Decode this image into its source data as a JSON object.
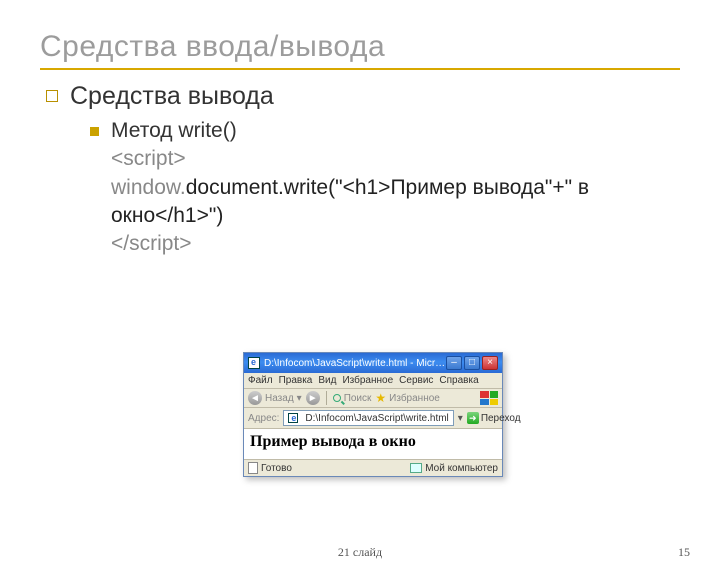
{
  "title": "Средства ввода/вывода",
  "lvl1": "Средства вывода",
  "lvl2": "Метод write()",
  "code": {
    "open": "<script>",
    "grayWord": "window.",
    "mid": "document.write(\"<h1>Пример вывода\"+\" в окно</h1>\")",
    "close": "</script>"
  },
  "shot": {
    "titlebar": "D:\\Infocom\\JavaScript\\write.html - Microso…",
    "menus": [
      "Файл",
      "Правка",
      "Вид",
      "Избранное",
      "Сервис",
      "Справка"
    ],
    "back": "Назад",
    "search": "Поиск",
    "fav": "Избранное",
    "addrLabel": "Адрес:",
    "addrValue": "D:\\Infocom\\JavaScript\\write.html",
    "go": "Переход",
    "contentH1": "Пример вывода в окно",
    "statusLeft": "Готово",
    "statusRight": "Мой компьютер"
  },
  "footer": "21 слайд",
  "pageNum": "15"
}
